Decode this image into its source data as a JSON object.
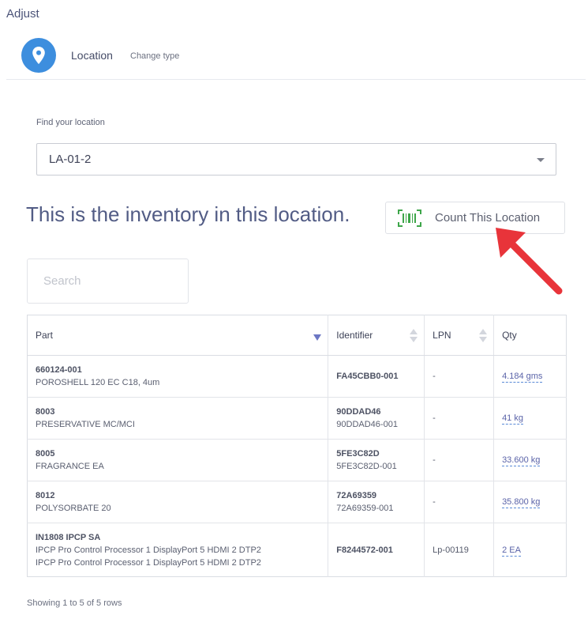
{
  "page": {
    "title": "Adjust"
  },
  "type_selector": {
    "label": "Location",
    "change_link": "Change type",
    "icon": "map-pin-icon"
  },
  "find_location": {
    "label": "Find your location",
    "value": "LA-01-2"
  },
  "inventory": {
    "headline": "This is the inventory in this location.",
    "count_button": {
      "label": "Count This Location",
      "icon": "barcode-icon"
    }
  },
  "search": {
    "placeholder": "Search"
  },
  "table": {
    "columns": {
      "part": "Part",
      "identifier": "Identifier",
      "lpn": "LPN",
      "qty": "Qty"
    },
    "rows": [
      {
        "part_no": "660124-001",
        "part_desc": "POROSHELL 120 EC C18, 4um",
        "part_desc2": "",
        "identifier": "FA45CBB0-001",
        "identifier2": "",
        "lpn": "-",
        "qty": "4.184 gms"
      },
      {
        "part_no": "8003",
        "part_desc": "PRESERVATIVE MC/MCI",
        "part_desc2": "",
        "identifier": "90DDAD46",
        "identifier2": "90DDAD46-001",
        "lpn": "-",
        "qty": "41 kg"
      },
      {
        "part_no": "8005",
        "part_desc": "FRAGRANCE EA",
        "part_desc2": "",
        "identifier": "5FE3C82D",
        "identifier2": "5FE3C82D-001",
        "lpn": "-",
        "qty": "33.600 kg"
      },
      {
        "part_no": "8012",
        "part_desc": "POLYSORBATE 20",
        "part_desc2": "",
        "identifier": "72A69359",
        "identifier2": "72A69359-001",
        "lpn": "-",
        "qty": "35.800 kg"
      },
      {
        "part_no": "IN1808 IPCP SA",
        "part_desc": "IPCP Pro Control Processor 1 DisplayPort 5 HDMI 2 DTP2",
        "part_desc2": "IPCP Pro Control Processor 1 DisplayPort 5 HDMI 2 DTP2",
        "identifier": "F8244572-001",
        "identifier2": "",
        "lpn": "Lp-00119",
        "qty": "2 EA"
      }
    ]
  },
  "footer": {
    "pagination_info": "Showing 1 to 5 of 5 rows"
  },
  "colors": {
    "accent": "#3d8ede",
    "annotation_arrow": "#e8343a",
    "barcode": "#3ea64a",
    "sort_active": "#6c77c4"
  }
}
